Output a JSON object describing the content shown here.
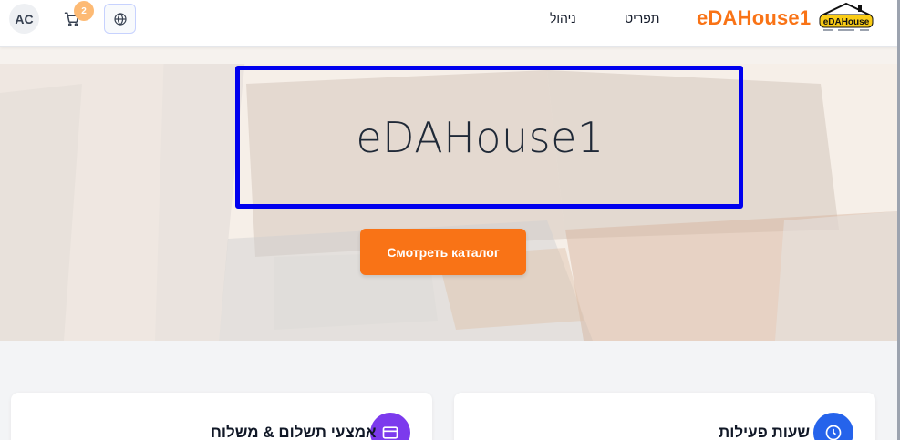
{
  "header": {
    "avatar_initials": "AC",
    "cart_count": "2",
    "nav": [
      {
        "label": "ניהול"
      },
      {
        "label": "תפריט"
      }
    ],
    "brand_name": "eDAHouse1",
    "logo_text": "eDAHouse",
    "cart_icon": "cart-icon",
    "language_icon": "globe-icon"
  },
  "hero": {
    "title": "eDAHouse1",
    "cta_label": "Смотреть каталог"
  },
  "cards": [
    {
      "title": "אמצעי תשלום & משלוח",
      "icon": "credit-card-icon"
    },
    {
      "title": "שעות פעילות",
      "icon": "clock-icon"
    }
  ],
  "colors": {
    "accent": "#f97316",
    "title_box_border": "#0000ee",
    "payment_icon_bg": "#7c3aed",
    "hours_icon_bg": "#2563eb"
  }
}
